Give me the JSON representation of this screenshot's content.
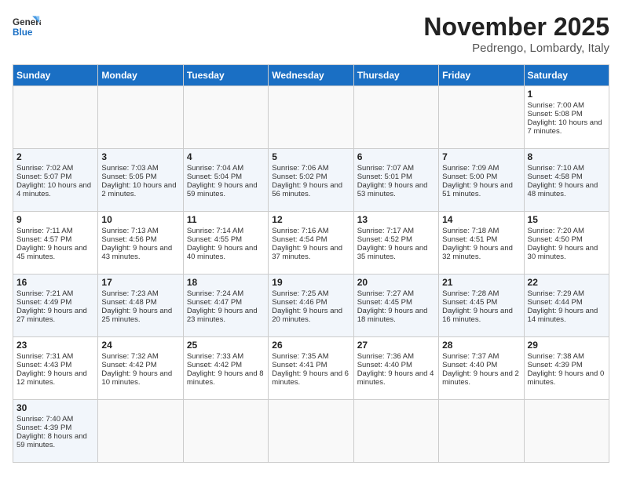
{
  "header": {
    "logo_general": "General",
    "logo_blue": "Blue",
    "month_year": "November 2025",
    "location": "Pedrengo, Lombardy, Italy"
  },
  "days_of_week": [
    "Sunday",
    "Monday",
    "Tuesday",
    "Wednesday",
    "Thursday",
    "Friday",
    "Saturday"
  ],
  "weeks": [
    {
      "days": [
        {
          "num": "",
          "data": ""
        },
        {
          "num": "",
          "data": ""
        },
        {
          "num": "",
          "data": ""
        },
        {
          "num": "",
          "data": ""
        },
        {
          "num": "",
          "data": ""
        },
        {
          "num": "",
          "data": ""
        },
        {
          "num": "1",
          "data": "Sunrise: 7:00 AM\nSunset: 5:08 PM\nDaylight: 10 hours and 7 minutes."
        }
      ]
    },
    {
      "days": [
        {
          "num": "2",
          "data": "Sunrise: 7:02 AM\nSunset: 5:07 PM\nDaylight: 10 hours and 4 minutes."
        },
        {
          "num": "3",
          "data": "Sunrise: 7:03 AM\nSunset: 5:05 PM\nDaylight: 10 hours and 2 minutes."
        },
        {
          "num": "4",
          "data": "Sunrise: 7:04 AM\nSunset: 5:04 PM\nDaylight: 9 hours and 59 minutes."
        },
        {
          "num": "5",
          "data": "Sunrise: 7:06 AM\nSunset: 5:02 PM\nDaylight: 9 hours and 56 minutes."
        },
        {
          "num": "6",
          "data": "Sunrise: 7:07 AM\nSunset: 5:01 PM\nDaylight: 9 hours and 53 minutes."
        },
        {
          "num": "7",
          "data": "Sunrise: 7:09 AM\nSunset: 5:00 PM\nDaylight: 9 hours and 51 minutes."
        },
        {
          "num": "8",
          "data": "Sunrise: 7:10 AM\nSunset: 4:58 PM\nDaylight: 9 hours and 48 minutes."
        }
      ]
    },
    {
      "days": [
        {
          "num": "9",
          "data": "Sunrise: 7:11 AM\nSunset: 4:57 PM\nDaylight: 9 hours and 45 minutes."
        },
        {
          "num": "10",
          "data": "Sunrise: 7:13 AM\nSunset: 4:56 PM\nDaylight: 9 hours and 43 minutes."
        },
        {
          "num": "11",
          "data": "Sunrise: 7:14 AM\nSunset: 4:55 PM\nDaylight: 9 hours and 40 minutes."
        },
        {
          "num": "12",
          "data": "Sunrise: 7:16 AM\nSunset: 4:54 PM\nDaylight: 9 hours and 37 minutes."
        },
        {
          "num": "13",
          "data": "Sunrise: 7:17 AM\nSunset: 4:52 PM\nDaylight: 9 hours and 35 minutes."
        },
        {
          "num": "14",
          "data": "Sunrise: 7:18 AM\nSunset: 4:51 PM\nDaylight: 9 hours and 32 minutes."
        },
        {
          "num": "15",
          "data": "Sunrise: 7:20 AM\nSunset: 4:50 PM\nDaylight: 9 hours and 30 minutes."
        }
      ]
    },
    {
      "days": [
        {
          "num": "16",
          "data": "Sunrise: 7:21 AM\nSunset: 4:49 PM\nDaylight: 9 hours and 27 minutes."
        },
        {
          "num": "17",
          "data": "Sunrise: 7:23 AM\nSunset: 4:48 PM\nDaylight: 9 hours and 25 minutes."
        },
        {
          "num": "18",
          "data": "Sunrise: 7:24 AM\nSunset: 4:47 PM\nDaylight: 9 hours and 23 minutes."
        },
        {
          "num": "19",
          "data": "Sunrise: 7:25 AM\nSunset: 4:46 PM\nDaylight: 9 hours and 20 minutes."
        },
        {
          "num": "20",
          "data": "Sunrise: 7:27 AM\nSunset: 4:45 PM\nDaylight: 9 hours and 18 minutes."
        },
        {
          "num": "21",
          "data": "Sunrise: 7:28 AM\nSunset: 4:45 PM\nDaylight: 9 hours and 16 minutes."
        },
        {
          "num": "22",
          "data": "Sunrise: 7:29 AM\nSunset: 4:44 PM\nDaylight: 9 hours and 14 minutes."
        }
      ]
    },
    {
      "days": [
        {
          "num": "23",
          "data": "Sunrise: 7:31 AM\nSunset: 4:43 PM\nDaylight: 9 hours and 12 minutes."
        },
        {
          "num": "24",
          "data": "Sunrise: 7:32 AM\nSunset: 4:42 PM\nDaylight: 9 hours and 10 minutes."
        },
        {
          "num": "25",
          "data": "Sunrise: 7:33 AM\nSunset: 4:42 PM\nDaylight: 9 hours and 8 minutes."
        },
        {
          "num": "26",
          "data": "Sunrise: 7:35 AM\nSunset: 4:41 PM\nDaylight: 9 hours and 6 minutes."
        },
        {
          "num": "27",
          "data": "Sunrise: 7:36 AM\nSunset: 4:40 PM\nDaylight: 9 hours and 4 minutes."
        },
        {
          "num": "28",
          "data": "Sunrise: 7:37 AM\nSunset: 4:40 PM\nDaylight: 9 hours and 2 minutes."
        },
        {
          "num": "29",
          "data": "Sunrise: 7:38 AM\nSunset: 4:39 PM\nDaylight: 9 hours and 0 minutes."
        }
      ]
    },
    {
      "days": [
        {
          "num": "30",
          "data": "Sunrise: 7:40 AM\nSunset: 4:39 PM\nDaylight: 8 hours and 59 minutes."
        },
        {
          "num": "",
          "data": ""
        },
        {
          "num": "",
          "data": ""
        },
        {
          "num": "",
          "data": ""
        },
        {
          "num": "",
          "data": ""
        },
        {
          "num": "",
          "data": ""
        },
        {
          "num": "",
          "data": ""
        }
      ]
    }
  ]
}
